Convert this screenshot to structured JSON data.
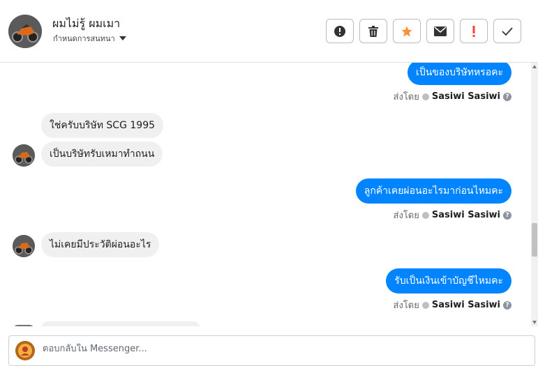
{
  "header": {
    "contact_name": "ผมไม่รู้ ผมเมา",
    "conversation_options_label": "กำหนดการสนทนา",
    "actions": [
      {
        "name": "report-spam-button",
        "icon": "exclamation-circle-icon"
      },
      {
        "name": "delete-button",
        "icon": "trash-icon"
      },
      {
        "name": "star-button",
        "icon": "star-icon",
        "color": "#f7923b"
      },
      {
        "name": "mark-unread-button",
        "icon": "envelope-icon"
      },
      {
        "name": "follow-up-button",
        "icon": "exclamation-mark-icon",
        "color": "#fa3e3e"
      },
      {
        "name": "mark-done-button",
        "icon": "check-icon"
      }
    ]
  },
  "messages": [
    {
      "direction": "out",
      "text": "เป็นของบริษัทหรอคะ"
    },
    {
      "direction": "meta",
      "sent_by_label": "ส่งโดย",
      "sender": "Sasiwi Sasiwi"
    },
    {
      "direction": "in",
      "text": "ใช่ครับบริษัท SCG 1995"
    },
    {
      "direction": "in",
      "text": "เป็นบริษัทรับเหมาทำถนน"
    },
    {
      "direction": "out",
      "text": "ลูกค้าเคยผ่อนอะไรมาก่อนไหมคะ"
    },
    {
      "direction": "meta",
      "sent_by_label": "ส่งโดย",
      "sender": "Sasiwi Sasiwi"
    },
    {
      "direction": "in",
      "text": "ไม่เคยมีประวัติผ่อนอะไร"
    },
    {
      "direction": "out",
      "text": "รับเป็นเงินเข้าบัญชีไหมคะ"
    },
    {
      "direction": "meta",
      "sent_by_label": "ส่งโดย",
      "sender": "Sasiwi Sasiwi"
    }
  ],
  "composer": {
    "placeholder": "ตอบกลับใน Messenger..."
  },
  "colors": {
    "outgoing_bubble": "#0084ff",
    "incoming_bubble": "#f0f0f0"
  }
}
